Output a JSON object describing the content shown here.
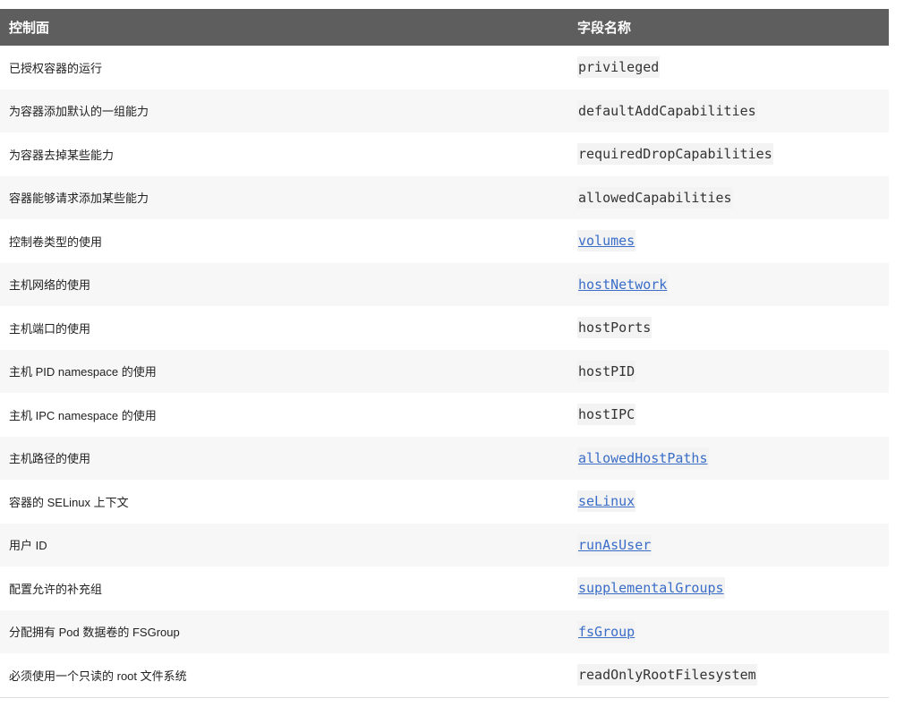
{
  "colors": {
    "header_bg": "#5e5e5e",
    "link": "#3a6dc8"
  },
  "table": {
    "headers": [
      "控制面",
      "字段名称"
    ],
    "rows": [
      {
        "control": "已授权容器的运行",
        "field": "privileged",
        "link": false
      },
      {
        "control": "为容器添加默认的一组能力",
        "field": "defaultAddCapabilities",
        "link": false
      },
      {
        "control": "为容器去掉某些能力",
        "field": "requiredDropCapabilities",
        "link": false
      },
      {
        "control": "容器能够请求添加某些能力",
        "field": "allowedCapabilities",
        "link": false
      },
      {
        "control": "控制卷类型的使用",
        "field": "volumes",
        "link": true
      },
      {
        "control": "主机网络的使用",
        "field": "hostNetwork",
        "link": true
      },
      {
        "control": "主机端口的使用",
        "field": "hostPorts",
        "link": false
      },
      {
        "control": "主机 PID namespace 的使用",
        "field": "hostPID",
        "link": false
      },
      {
        "control": "主机 IPC namespace 的使用",
        "field": "hostIPC",
        "link": false
      },
      {
        "control": "主机路径的使用",
        "field": "allowedHostPaths",
        "link": true
      },
      {
        "control": "容器的 SELinux 上下文",
        "field": "seLinux",
        "link": true
      },
      {
        "control": "用户 ID",
        "field": "runAsUser",
        "link": true
      },
      {
        "control": "配置允许的补充组",
        "field": "supplementalGroups",
        "link": true
      },
      {
        "control": "分配拥有 Pod 数据卷的 FSGroup",
        "field": "fsGroup",
        "link": true
      },
      {
        "control": "必须使用一个只读的 root 文件系统",
        "field": "readOnlyRootFilesystem",
        "link": false
      }
    ]
  }
}
